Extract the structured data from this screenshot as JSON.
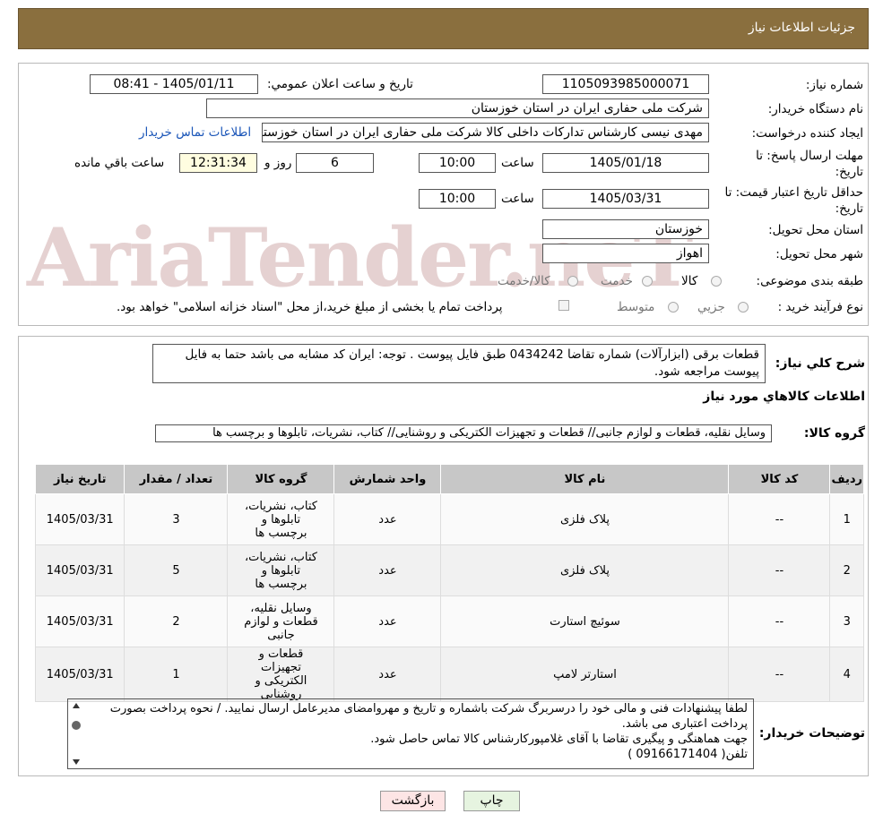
{
  "header": {
    "title": "جزئيات اطلاعات نياز"
  },
  "watermark": "AriaTender.neT",
  "form": {
    "need_number_label": "شماره نياز:",
    "need_number": "1105093985000071",
    "announce_label": "تاريخ و ساعت اعلان عمومي:",
    "announce_value": "1405/01/11 - 08:41",
    "buyer_label": "نام دستگاه خريدار:",
    "buyer_value": "شرکت ملی حفاری ایران در استان خوزستان",
    "creator_label": "ايجاد کننده درخواست:",
    "creator_value": "مهدی نیسی کارشناس تدارکات داخلی کالا شرکت ملی حفاری ایران در استان خوزستان",
    "contact_link": "اطلاعات تماس خريدار",
    "deadline_label": "مهلت ارسال پاسخ: تا تاريخ:",
    "deadline_date": "1405/01/18",
    "time_label": "ساعت",
    "deadline_time": "10:00",
    "days_value": "6",
    "days_label": "روز و",
    "remaining_time": "12:31:34",
    "remaining_label": "ساعت باقي مانده",
    "validity_label": "حداقل تاريخ اعتبار قيمت: تا تاريخ:",
    "validity_date": "1405/03/31",
    "validity_time": "10:00",
    "province_label": "استان محل تحويل:",
    "province_value": "خوزستان",
    "city_label": "شهر محل تحويل:",
    "city_value": "اهواز",
    "category_label": "طبقه بندی موضوعی:",
    "category_options": [
      "کالا",
      "خدمت",
      "کالا/خدمت"
    ],
    "process_label": "نوع فرآيند خريد :",
    "process_options": [
      "جزيي",
      "متوسط"
    ],
    "payment_note": "پرداخت تمام يا بخشی از مبلغ خريد،از محل \"اسناد خزانه اسلامی\" خواهد بود."
  },
  "summary": {
    "label": "شرح كلي نياز:",
    "text": "قطعات برقی (ابزارآلات)  شماره تقاضا 0434242 طبق فایل پیوست . توجه: ایران کد مشابه می باشد حتما به فایل پیوست مراجعه شود.",
    "goods_info_title": "اطلاعات كالاهاي مورد نياز",
    "group_label": "گروه كالا:",
    "group_value": "وسایل نقلیه، قطعات و لوازم جانبی// قطعات و تجهیزات الکتریکی و روشنایی// کتاب، نشریات، تابلوها و برچسب ها"
  },
  "table": {
    "columns": [
      "رديف",
      "کد کالا",
      "نام کالا",
      "واحد شمارش",
      "گروه کالا",
      "تعداد / مقدار",
      "تاريخ نياز"
    ],
    "rows": [
      [
        "1",
        "--",
        "پلاک فلزی",
        "عدد",
        "کتاب، نشریات، تابلوها و برچسب ها",
        "3",
        "1405/03/31"
      ],
      [
        "2",
        "--",
        "پلاک فلزی",
        "عدد",
        "کتاب، نشریات، تابلوها و برچسب ها",
        "5",
        "1405/03/31"
      ],
      [
        "3",
        "--",
        "سوئیچ استارت",
        "عدد",
        "وسایل نقلیه، قطعات و لوازم جانبی",
        "2",
        "1405/03/31"
      ],
      [
        "4",
        "--",
        "استارتر لامپ",
        "عدد",
        "قطعات و تجهیزات الکتریکی و روشنایی",
        "1",
        "1405/03/31"
      ]
    ]
  },
  "buyer_notes": {
    "label": "توضيحات خريدار:",
    "lines": [
      "لطفا پیشنهادات فنی و مالی خود را درسربرگ شرکت باشماره و تاریخ و مهروامضای مدیرعامل ارسال نمایید. / نحوه پرداخت بصورت پرداخت اعتباری می باشد.",
      "جهت هماهنگی و پیگیری تقاضا با آقای  غلامپورکارشناس کالا  تماس حاصل شود.",
      "تلفن( 09166171404 )"
    ]
  },
  "buttons": {
    "print": "چاپ",
    "back": "بازگشت"
  },
  "colors": {
    "header_bg": "#8a6f3e",
    "back_btn": "#fde5e5",
    "print_btn": "#e6f4e0"
  }
}
